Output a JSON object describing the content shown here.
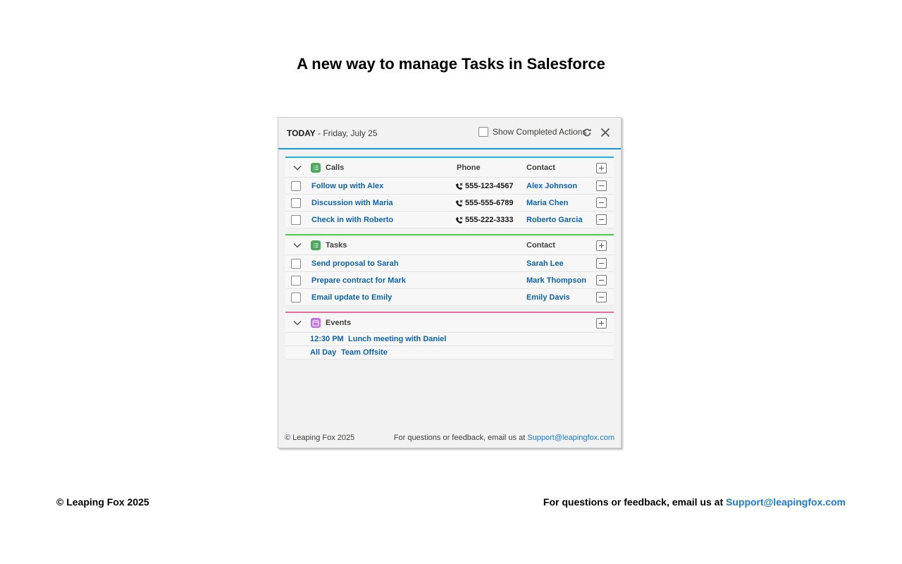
{
  "page_title": "A new way to manage Tasks in Salesforce",
  "panel": {
    "header": {
      "today_label": "TODAY",
      "date_text": " - Friday, July 25",
      "show_completed_label": "Show Completed Actions",
      "refresh_icon": "refresh-icon",
      "close_icon": "close-icon"
    },
    "calls": {
      "label": "Calls",
      "phone_header": "Phone",
      "contact_header": "Contact",
      "accent_color": "#1db5d8",
      "icon_color": "#4bab5c",
      "rows": [
        {
          "title": "Follow up with Alex",
          "phone": "555-123-4567",
          "contact": "Alex Johnson"
        },
        {
          "title": "Discussion with Maria",
          "phone": "555-555-6789",
          "contact": "Maria Chen"
        },
        {
          "title": "Check in with Roberto",
          "phone": "555-222-3333",
          "contact": "Roberto Garcia"
        }
      ]
    },
    "tasks": {
      "label": "Tasks",
      "contact_header": "Contact",
      "accent_color": "#4bca4b",
      "icon_color": "#4bab5c",
      "rows": [
        {
          "title": "Send proposal to Sarah",
          "contact": "Sarah Lee"
        },
        {
          "title": "Prepare contract for Mark",
          "contact": "Mark Thompson"
        },
        {
          "title": "Email update to Emily",
          "contact": "Emily Davis"
        }
      ]
    },
    "events": {
      "label": "Events",
      "accent_color": "#ea6d9a",
      "icon_color": "#c46ce8",
      "rows": [
        {
          "time": "12:30 PM",
          "title": "Lunch meeting with Daniel"
        },
        {
          "time": "All Day",
          "title": "Team Offsite"
        }
      ]
    },
    "footer": {
      "copyright": "© Leaping Fox 2025",
      "feedback_text": "For questions or feedback, email us at ",
      "email": "Support@leapingfox.com"
    }
  },
  "page_footer": {
    "copyright": "© Leaping Fox 2025",
    "feedback_text": "For questions or feedback, email us at ",
    "email": "Support@leapingfox.com"
  },
  "colors": {
    "link": "#0b63b5",
    "header_rule": "#1b96d4"
  }
}
